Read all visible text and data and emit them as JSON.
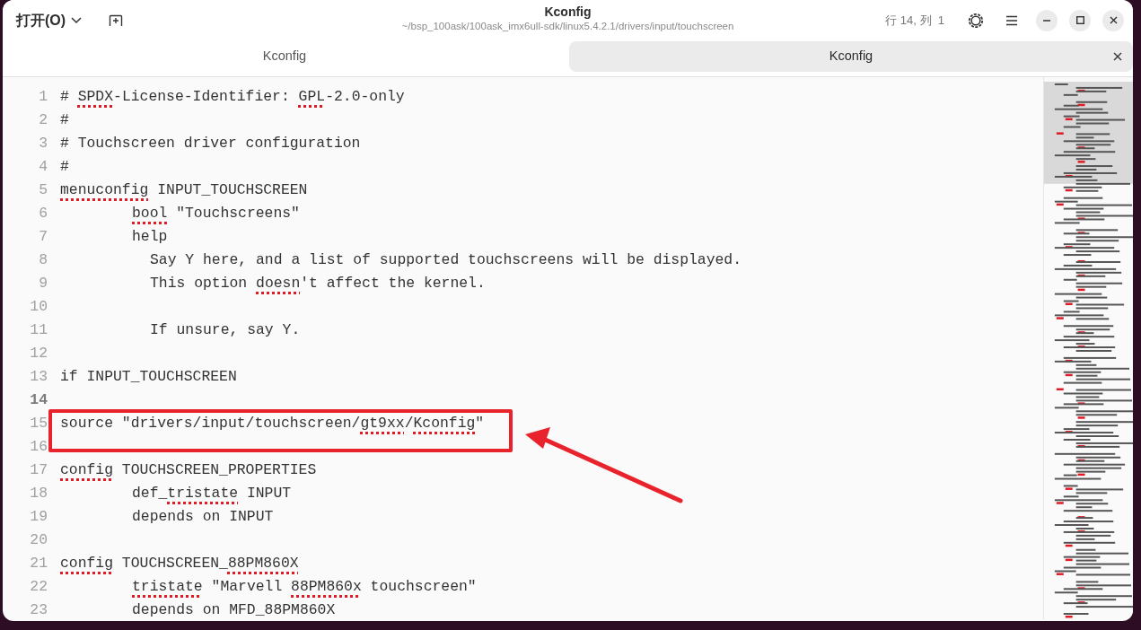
{
  "header": {
    "open_button": "打开(O)",
    "title": "Kconfig",
    "path": "~/bsp_100ask/100ask_imx6ull-sdk/linux5.4.2.1/drivers/input/touchscreen",
    "cursor_position": "行 14, 列  1"
  },
  "tabs": [
    {
      "label": "Kconfig",
      "selected": false
    },
    {
      "label": "Kconfig",
      "selected": true
    }
  ],
  "lines": [
    {
      "number": "1",
      "kind": "top",
      "current": false,
      "segments": [
        {
          "text": "# ",
          "misspelled": false
        },
        {
          "text": "SPDX",
          "misspelled": true
        },
        {
          "text": "-License-Identifier: ",
          "misspelled": false
        },
        {
          "text": "GPL",
          "misspelled": true
        },
        {
          "text": "-2.0-only",
          "misspelled": false
        }
      ]
    },
    {
      "number": "2",
      "kind": "top",
      "current": false,
      "segments": [
        {
          "text": "#",
          "misspelled": false
        }
      ]
    },
    {
      "number": "3",
      "kind": "top",
      "current": false,
      "segments": [
        {
          "text": "# Touchscreen driver configuration",
          "misspelled": false
        }
      ]
    },
    {
      "number": "4",
      "kind": "top",
      "current": false,
      "segments": [
        {
          "text": "#",
          "misspelled": false
        }
      ]
    },
    {
      "number": "5",
      "kind": "top",
      "current": false,
      "segments": [
        {
          "text": "menuconfig",
          "misspelled": true
        },
        {
          "text": " INPUT_TOUCHSCREEN",
          "misspelled": false
        }
      ]
    },
    {
      "number": "6",
      "kind": "option",
      "current": false,
      "segments": [
        {
          "text": "bool",
          "misspelled": true
        },
        {
          "text": " \"Touchscreens\"",
          "misspelled": false
        }
      ]
    },
    {
      "number": "7",
      "kind": "option",
      "current": false,
      "segments": [
        {
          "text": "help",
          "misspelled": false
        }
      ]
    },
    {
      "number": "8",
      "kind": "help",
      "current": false,
      "segments": [
        {
          "text": "Say Y here, and a list of supported touchscreens will be displayed.",
          "misspelled": false
        }
      ]
    },
    {
      "number": "9",
      "kind": "help",
      "current": false,
      "segments": [
        {
          "text": "This option ",
          "misspelled": false
        },
        {
          "text": "doesn",
          "misspelled": true
        },
        {
          "text": "'t affect the kernel.",
          "misspelled": false
        }
      ]
    },
    {
      "number": "10",
      "current": false
    },
    {
      "number": "11",
      "kind": "help",
      "current": false,
      "segments": [
        {
          "text": "If unsure, say Y.",
          "misspelled": false
        }
      ]
    },
    {
      "number": "12",
      "current": false
    },
    {
      "number": "13",
      "kind": "top",
      "current": false,
      "segments": [
        {
          "text": "if INPUT_TOUCHSCREEN",
          "misspelled": false
        }
      ]
    },
    {
      "number": "14",
      "current": true
    },
    {
      "number": "15",
      "kind": "top",
      "current": false,
      "segments": [
        {
          "text": "source \"drivers/input/touchscreen/",
          "misspelled": false
        },
        {
          "text": "gt9xx",
          "misspelled": true
        },
        {
          "text": "/",
          "misspelled": false
        },
        {
          "text": "Kconfig",
          "misspelled": true
        },
        {
          "text": "\"",
          "misspelled": false
        }
      ]
    },
    {
      "number": "16",
      "current": false
    },
    {
      "number": "17",
      "kind": "top",
      "current": false,
      "segments": [
        {
          "text": "config",
          "misspelled": true
        },
        {
          "text": " TOUCHSCREEN_PROPERTIES",
          "misspelled": false
        }
      ]
    },
    {
      "number": "18",
      "kind": "option",
      "current": false,
      "segments": [
        {
          "text": "def_",
          "misspelled": false
        },
        {
          "text": "tristate",
          "misspelled": true
        },
        {
          "text": " INPUT",
          "misspelled": false
        }
      ]
    },
    {
      "number": "19",
      "kind": "option",
      "current": false,
      "segments": [
        {
          "text": "depends on INPUT",
          "misspelled": false
        }
      ]
    },
    {
      "number": "20",
      "current": false
    },
    {
      "number": "21",
      "kind": "top",
      "current": false,
      "segments": [
        {
          "text": "config",
          "misspelled": true
        },
        {
          "text": " TOUCHSCREEN_",
          "misspelled": false
        },
        {
          "text": "88PM860X",
          "misspelled": true
        }
      ]
    },
    {
      "number": "22",
      "kind": "option",
      "current": false,
      "segments": [
        {
          "text": "tristate",
          "misspelled": true
        },
        {
          "text": " \"Marvell ",
          "misspelled": false
        },
        {
          "text": "88PM860x",
          "misspelled": true
        },
        {
          "text": " touchscreen\"",
          "misspelled": false
        }
      ]
    },
    {
      "number": "23",
      "kind": "option",
      "current": false,
      "segments": [
        {
          "text": "depends on MFD_88PM860X",
          "misspelled": false
        }
      ]
    }
  ]
}
